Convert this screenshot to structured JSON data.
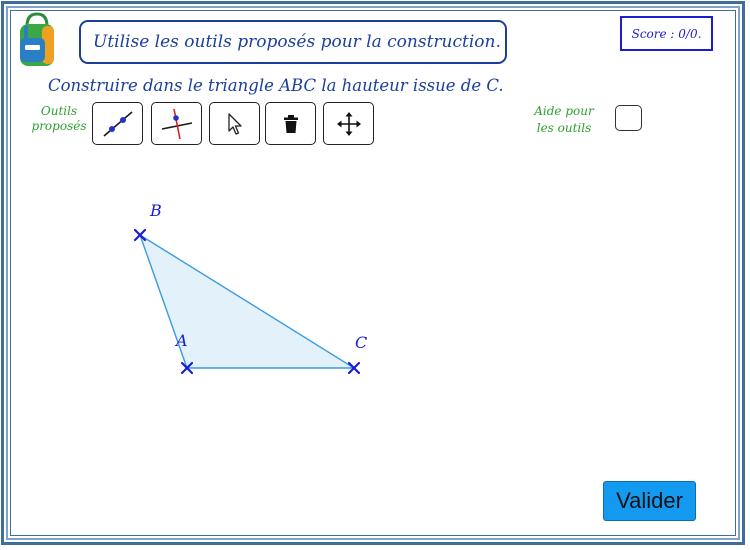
{
  "instruction": "Utilise les outils proposés pour la construction.",
  "score": "Score : 0/0.",
  "task": "Construire dans le triangle ABC la hauteur issue de C.",
  "tools": {
    "label_line1": "Outils",
    "label_line2": "proposés",
    "items": [
      {
        "name": "line-tool",
        "icon": "line-through-two-points-icon"
      },
      {
        "name": "perpendicular-tool",
        "icon": "perpendicular-line-icon"
      },
      {
        "name": "move-pointer-tool",
        "icon": "arrow-pointer-icon"
      },
      {
        "name": "delete-tool",
        "icon": "trash-icon"
      },
      {
        "name": "move-view-tool",
        "icon": "move-arrows-icon"
      }
    ]
  },
  "help": {
    "label_line1": "Aide pour",
    "label_line2": "les outils",
    "checked": false
  },
  "figure": {
    "points": {
      "A": "A",
      "B": "B",
      "C": "C"
    },
    "fill_color": "#e3f1fb",
    "edge_color": "#3a9be0",
    "point_color": "#1c1cd0"
  },
  "submit_label": "Valider",
  "colors": {
    "accent_blue": "#1c3f9c",
    "green_label": "#2ea02e",
    "button_blue": "#1499f0"
  }
}
